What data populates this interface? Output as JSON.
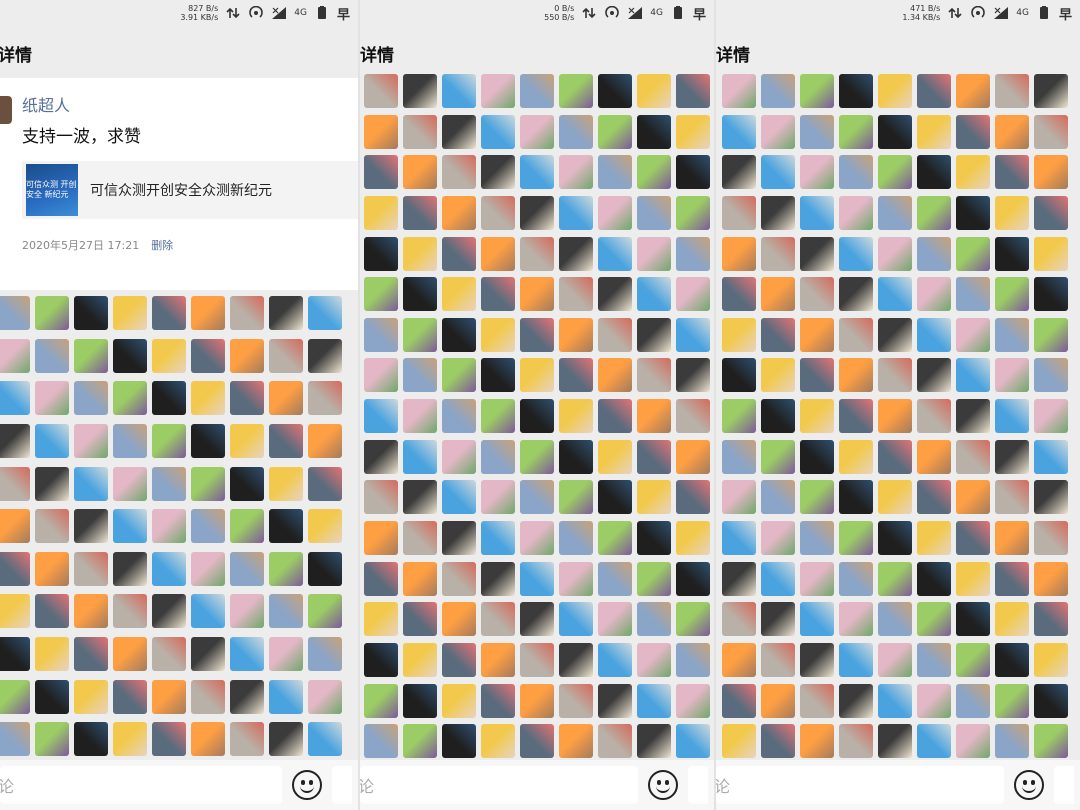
{
  "panels": [
    {
      "status": {
        "speed_up": "827 B/s",
        "speed_down": "3.91 KB/s",
        "net": "4G",
        "clock": "早"
      },
      "nav_title": "详情",
      "post": {
        "user": "纸超人",
        "text": "支持一波，求赞",
        "link_thumb_text": "可信众测 开创安全 新纪元",
        "link_title": "可信众测开创安全众测新纪元",
        "time": "2020年5月27日 17:21",
        "delete_label": "删除"
      },
      "comment_placeholder": "论"
    },
    {
      "status": {
        "speed_up": "0 B/s",
        "speed_down": "550 B/s",
        "net": "4G",
        "clock": "早"
      },
      "nav_title": "详情",
      "comment_placeholder": "论"
    },
    {
      "status": {
        "speed_up": "471 B/s",
        "speed_down": "1.34 KB/s",
        "net": "4G",
        "clock": "早"
      },
      "nav_title": "详情",
      "comment_placeholder": "论"
    }
  ],
  "icons": {
    "data_arrows": "data-transfer-icon",
    "hotspot": "hotspot-icon",
    "signal": "signal-icon",
    "battery": "battery-icon",
    "emoji": "emoji-icon",
    "avatar": "user-avatar"
  },
  "colors": {
    "link_blue": "#56709b",
    "background": "#ededed",
    "card": "#ffffff"
  }
}
